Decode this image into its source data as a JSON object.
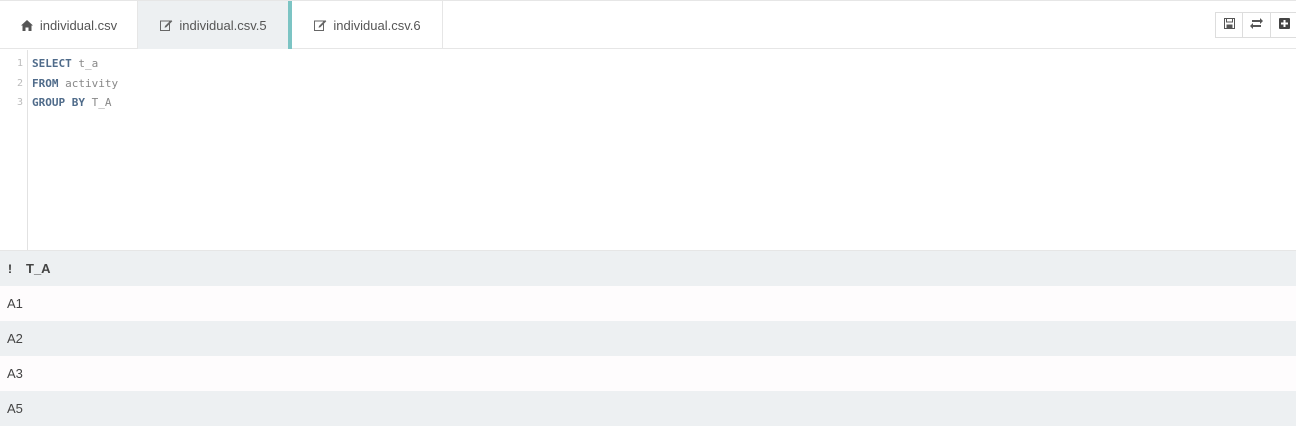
{
  "tabs": [
    {
      "label": "individual.csv",
      "icon": "home-icon"
    },
    {
      "label": "individual.csv.5",
      "icon": "edit-icon"
    },
    {
      "label": "individual.csv.6",
      "icon": "edit-icon"
    }
  ],
  "toolbar": {
    "save_icon": "save-icon",
    "refresh_icon": "refresh-icon",
    "add_icon": "add-icon"
  },
  "editor": {
    "line_numbers": [
      "1",
      "2",
      "3"
    ],
    "lines": [
      {
        "keyword": "SELECT",
        "rest": " t_a"
      },
      {
        "keyword": "FROM",
        "rest": " activity"
      },
      {
        "keyword": "GROUP BY",
        "rest": " T_A"
      }
    ]
  },
  "results": {
    "marker": "!",
    "column": "T_A",
    "rows": [
      "A1",
      "A2",
      "A3",
      "A5"
    ]
  },
  "colors": {
    "active_tab_accent": "#7cc4c4",
    "keyword": "#4f6b8a",
    "row_alt": "#edf0f2"
  }
}
